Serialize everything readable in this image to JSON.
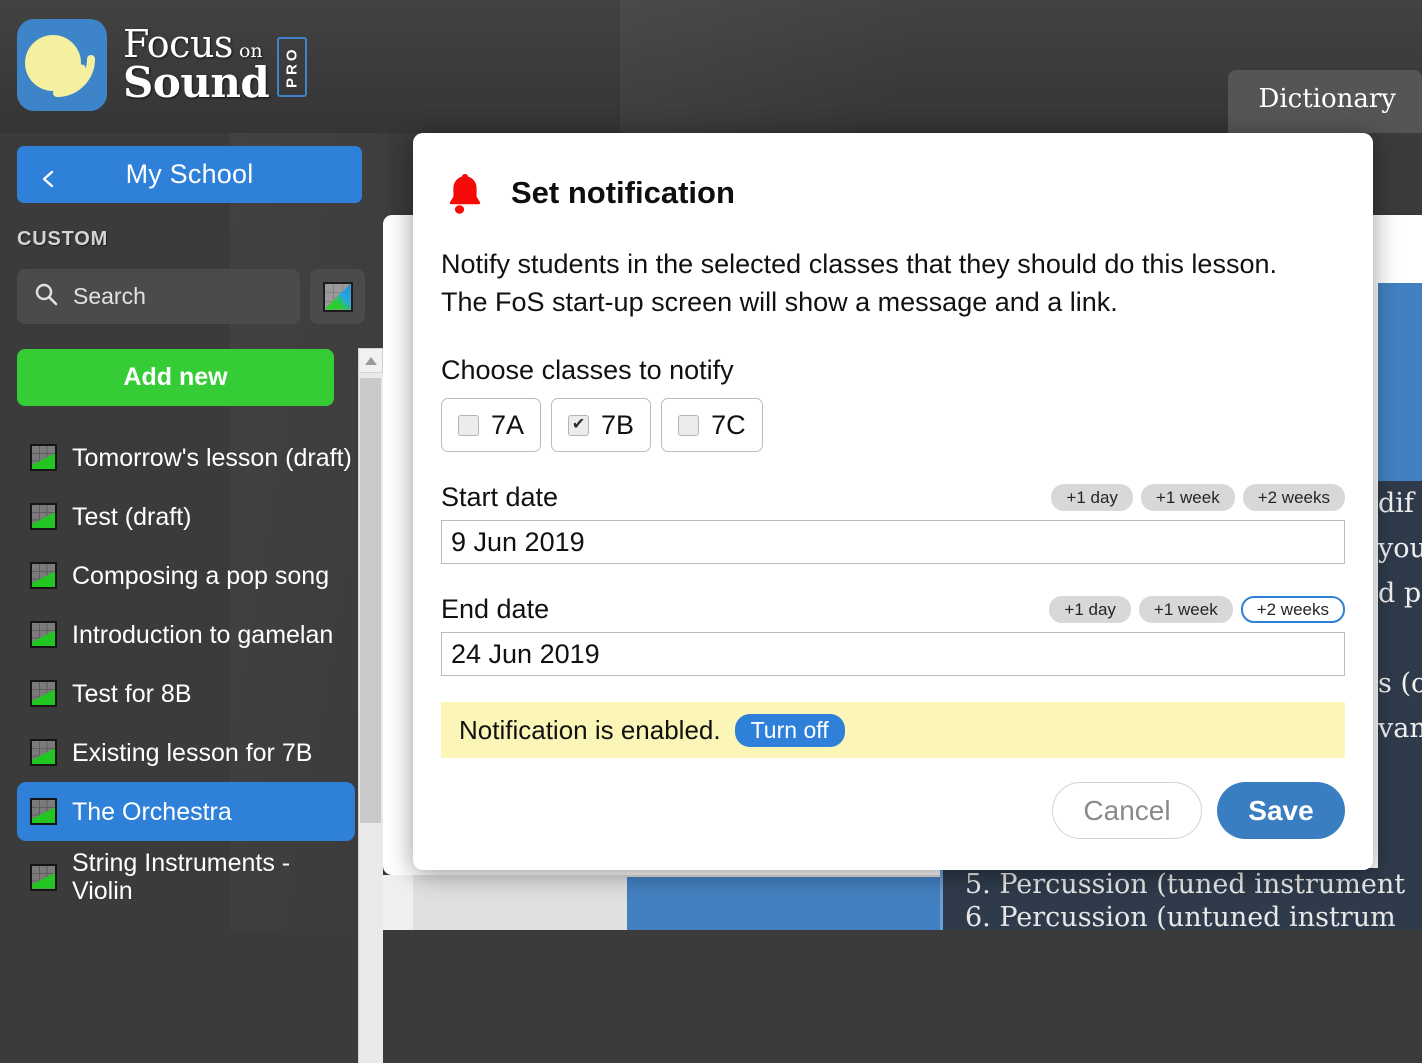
{
  "app": {
    "brand_line1": "Focus",
    "brand_on": "on",
    "brand_line2": "Sound",
    "brand_badge": "PRO",
    "logo_bg": "#3d85c8",
    "logo_circle": "#f4f0a0"
  },
  "topbar": {
    "dictionary_tab": "Dictionary"
  },
  "sidebar": {
    "back_label": "My School",
    "section_label": "CUSTOM",
    "search_placeholder": "Search",
    "filter_icon": "chart-filter-icon",
    "add_new_label": "Add new",
    "items": [
      {
        "label": "Tomorrow's lesson (draft)",
        "selected": false
      },
      {
        "label": "Test (draft)",
        "selected": false
      },
      {
        "label": "Composing a pop song",
        "selected": false
      },
      {
        "label": "Introduction to gamelan",
        "selected": false
      },
      {
        "label": "Test for 8B",
        "selected": false
      },
      {
        "label": "Existing lesson for 7B",
        "selected": false
      },
      {
        "label": "The Orchestra",
        "selected": true
      },
      {
        "label": "String Instruments - Violin",
        "selected": false
      }
    ],
    "accent": "#2f80d8",
    "add_new_color": "#35cc35"
  },
  "background_content": {
    "right_fragments": [
      "dif",
      "you",
      "d pe",
      "s (o",
      "vant"
    ],
    "bottom_lines": [
      "5. Percussion (tuned instrument",
      "6. Percussion (untuned instrum"
    ]
  },
  "modal": {
    "icon": "bell-icon",
    "icon_color": "#f50a0a",
    "title": "Set notification",
    "body": "Notify students in the selected classes that they should do this lesson. The FoS start-up screen will show a message and a link.",
    "body_line1": "Notify students in the selected classes that they should do this lesson.",
    "body_line2": "The FoS start-up screen will show a message and a link.",
    "classes_label": "Choose classes to notify",
    "classes": [
      {
        "name": "7A",
        "checked": false
      },
      {
        "name": "7B",
        "checked": true
      },
      {
        "name": "7C",
        "checked": false
      }
    ],
    "start_date": {
      "label": "Start date",
      "value": "9 Jun 2019",
      "pills": [
        {
          "label": "+1 day",
          "focused": false
        },
        {
          "label": "+1 week",
          "focused": false
        },
        {
          "label": "+2 weeks",
          "focused": false
        }
      ]
    },
    "end_date": {
      "label": "End date",
      "value": "24 Jun 2019",
      "pills": [
        {
          "label": "+1 day",
          "focused": false
        },
        {
          "label": "+1 week",
          "focused": false
        },
        {
          "label": "+2 weeks",
          "focused": true
        }
      ]
    },
    "notice": {
      "text": "Notification is enabled.",
      "button_label": "Turn off",
      "bg": "#fbf5b7",
      "button_color": "#2f80d8"
    },
    "cancel_label": "Cancel",
    "save_label": "Save",
    "save_color": "#3a7ec2"
  }
}
